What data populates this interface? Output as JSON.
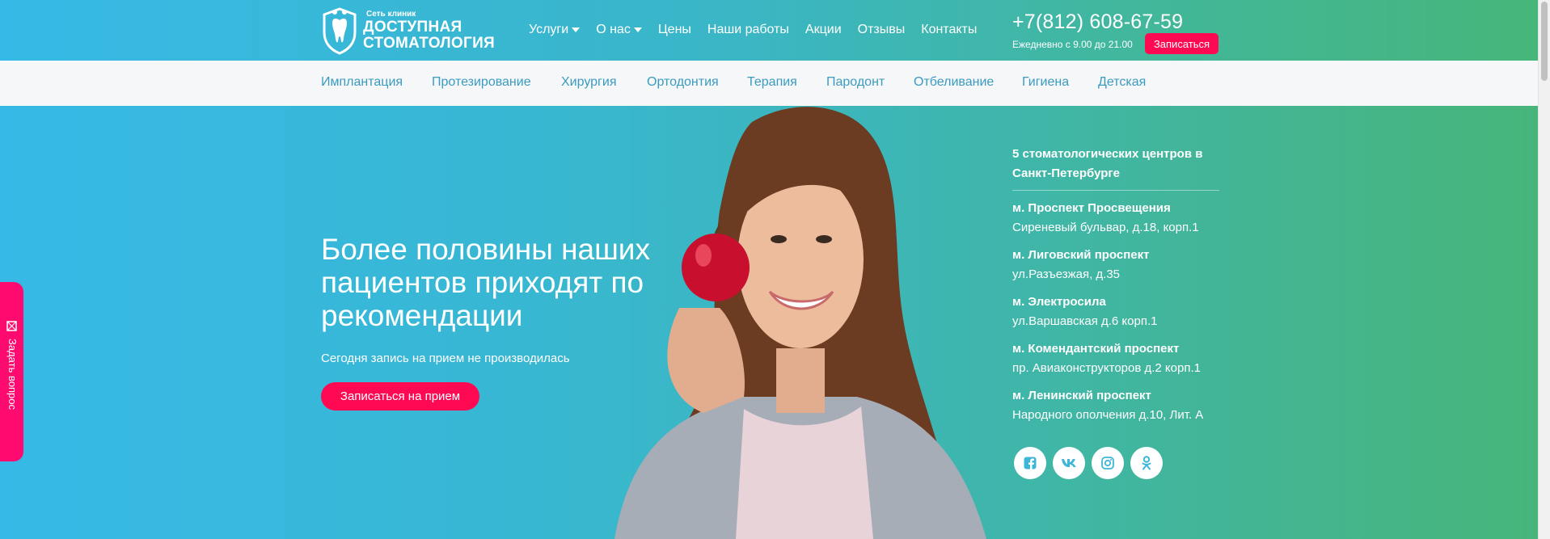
{
  "header": {
    "logo": {
      "small": "Сеть клиник",
      "line1": "ДОСТУПНАЯ",
      "line2": "СТОМАТОЛОГИЯ"
    },
    "nav": [
      {
        "label": "Услуги",
        "dropdown": true
      },
      {
        "label": "О нас",
        "dropdown": true
      },
      {
        "label": "Цены"
      },
      {
        "label": "Наши работы"
      },
      {
        "label": "Акции"
      },
      {
        "label": "Отзывы"
      },
      {
        "label": "Контакты"
      }
    ],
    "phone": "+7(812) 608-67-59",
    "hours": "Ежедневно с 9.00 до 21.00",
    "signup_label": "Записаться"
  },
  "subnav": [
    "Имплантация",
    "Протезирование",
    "Хирургия",
    "Ортодонтия",
    "Терапия",
    "Пародонт",
    "Отбеливание",
    "Гигиена",
    "Детская"
  ],
  "hero": {
    "title": "Более половины наших пациентов приходят по рекомендации",
    "subtitle": "Сегодня запись на прием не производилась",
    "cta_label": "Записаться на прием"
  },
  "clinics": {
    "title": "5 стоматологических центров в Санкт-Петербурге",
    "items": [
      {
        "metro": "м. Проспект Просвещения",
        "address": "Сиреневый бульвар, д.18, корп.1"
      },
      {
        "metro": "м. Лиговский проспект",
        "address": "ул.Разъезжая, д.35"
      },
      {
        "metro": "м. Электросила",
        "address": "ул.Варшавская д.6 корп.1"
      },
      {
        "metro": "м. Комендантский проспект",
        "address": "пр. Авиаконструкторов д.2 корп.1"
      },
      {
        "metro": "м. Ленинский проспект",
        "address": "Народного ополчения д.10, Лит. А"
      }
    ]
  },
  "social": [
    "facebook-icon",
    "vk-icon",
    "instagram-icon",
    "odnoklassniki-icon"
  ],
  "side_tab": {
    "label": "Задать вопрос"
  },
  "colors": {
    "accent": "#ff0a52",
    "side_tab": "#ff0a6e",
    "gradient_start": "#36b9e6",
    "gradient_end": "#47b57a",
    "subnav_link": "#3a9bc1",
    "icon": "#3db6d8"
  }
}
